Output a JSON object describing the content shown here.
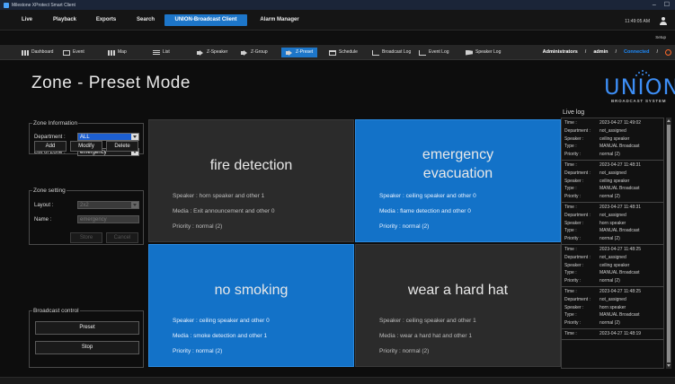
{
  "window": {
    "title": "Milestone XProtect Smart Client",
    "controls": [
      "–",
      "☐"
    ]
  },
  "menu": {
    "items": [
      {
        "label": "Live"
      },
      {
        "label": "Playback"
      },
      {
        "label": "Exports"
      },
      {
        "label": "Search"
      },
      {
        "label": "UNION-Broadcast Client",
        "active": true
      },
      {
        "label": "Alarm Manager"
      }
    ],
    "clock": "11:49:05 AM",
    "setup_label": "Setup"
  },
  "toolbar": {
    "items": [
      {
        "label": "Dashboard",
        "icon": "dashboard-icon"
      },
      {
        "label": "Event",
        "icon": "event-icon"
      },
      {
        "label": "Map",
        "icon": "map-icon"
      },
      {
        "label": "List",
        "icon": "list-icon"
      },
      {
        "label": "Z-Speaker",
        "icon": "speaker-icon"
      },
      {
        "label": "Z-Group",
        "icon": "group-icon"
      },
      {
        "label": "Z-Preset",
        "icon": "preset-icon",
        "active": true
      },
      {
        "label": "Schedule",
        "icon": "calendar-icon"
      },
      {
        "label": "Broadcast Log",
        "icon": "broadcast-log-icon"
      },
      {
        "label": "Event Log",
        "icon": "event-log-icon"
      },
      {
        "label": "Speaker Log",
        "icon": "speaker-log-icon"
      }
    ],
    "admin": {
      "role": "Administrators",
      "user": "admin",
      "status": "Connected",
      "separator": "/"
    }
  },
  "page": {
    "title": "Zone - Preset Mode",
    "logo_text": "UNION",
    "logo_sub": "BROADCAST SYSTEM"
  },
  "zone_information": {
    "legend": "Zone Information",
    "department_label": "Department :",
    "department_value": "ALL",
    "list_label": "List of Zone :",
    "list_value": "emergency",
    "buttons": {
      "add": "Add",
      "modify": "Modify",
      "delete": "Delete"
    }
  },
  "zone_setting": {
    "legend": "Zone setting",
    "layout_label": "Layout :",
    "layout_value": "2x2",
    "name_label": "Name :",
    "name_value": "emergency",
    "buttons": {
      "store": "Store",
      "cancel": "Cancel"
    }
  },
  "broadcast_control": {
    "legend": "Broadcast control",
    "preset_label": "Preset",
    "stop_label": "Stop"
  },
  "zones": [
    {
      "name": "fire detection",
      "speaker": "Speaker : horn speaker and other 1",
      "media": "Media : Exit announcement  and other 0",
      "priority": "Priority : normal (2)",
      "active": false
    },
    {
      "name_line1": "emergency",
      "name_line2": "evacuation",
      "speaker": "Speaker : ceiling speaker and other 0",
      "media": "Media : flame detection and other 0",
      "priority": "Priority : normal (2)",
      "active": true
    },
    {
      "name": "no smoking",
      "speaker": "Speaker : ceiling speaker and other 0",
      "media": "Media : smoke detection and other 1",
      "priority": "Priority : normal (2)",
      "active": true
    },
    {
      "name": "wear a hard hat",
      "speaker": "Speaker : ceiling speaker and other 1",
      "media": "Media : wear a hard hat and other 1",
      "priority": "Priority : normal (2)",
      "active": false
    }
  ],
  "live_log": {
    "title": "Live log",
    "keys": {
      "time": "Time :",
      "department": "Department :",
      "speaker": "Speaker :",
      "type": "Type :",
      "priority": "Priority :"
    },
    "entries": [
      {
        "time": "2023-04-27 11:49:02",
        "department": "not_assigned",
        "speaker": "ceiling speaker",
        "type": "MANUAL Broadcast",
        "priority": "normal (2)"
      },
      {
        "time": "2023-04-27 11:48:31",
        "department": "not_assigned",
        "speaker": "ceiling speaker",
        "type": "MANUAL Broadcast",
        "priority": "normal (2)"
      },
      {
        "time": "2023-04-27 11:48:31",
        "department": "not_assigned",
        "speaker": "horn speaker",
        "type": "MANUAL Broadcast",
        "priority": "normal (2)"
      },
      {
        "time": "2023-04-27 11:48:25",
        "department": "not_assigned",
        "speaker": "ceiling speaker",
        "type": "MANUAL Broadcast",
        "priority": "normal (2)"
      },
      {
        "time": "2023-04-27 11:48:25",
        "department": "not_assigned",
        "speaker": "horn speaker",
        "type": "MANUAL Broadcast",
        "priority": "normal (2)"
      },
      {
        "time": "2023-04-27 11:48:19"
      }
    ]
  },
  "colors": {
    "accent": "#1d76c9",
    "zone_active": "#1372c8",
    "zone_idle": "#2b2b2b",
    "connected": "#1d8cff",
    "power": "#ff6a2a"
  }
}
